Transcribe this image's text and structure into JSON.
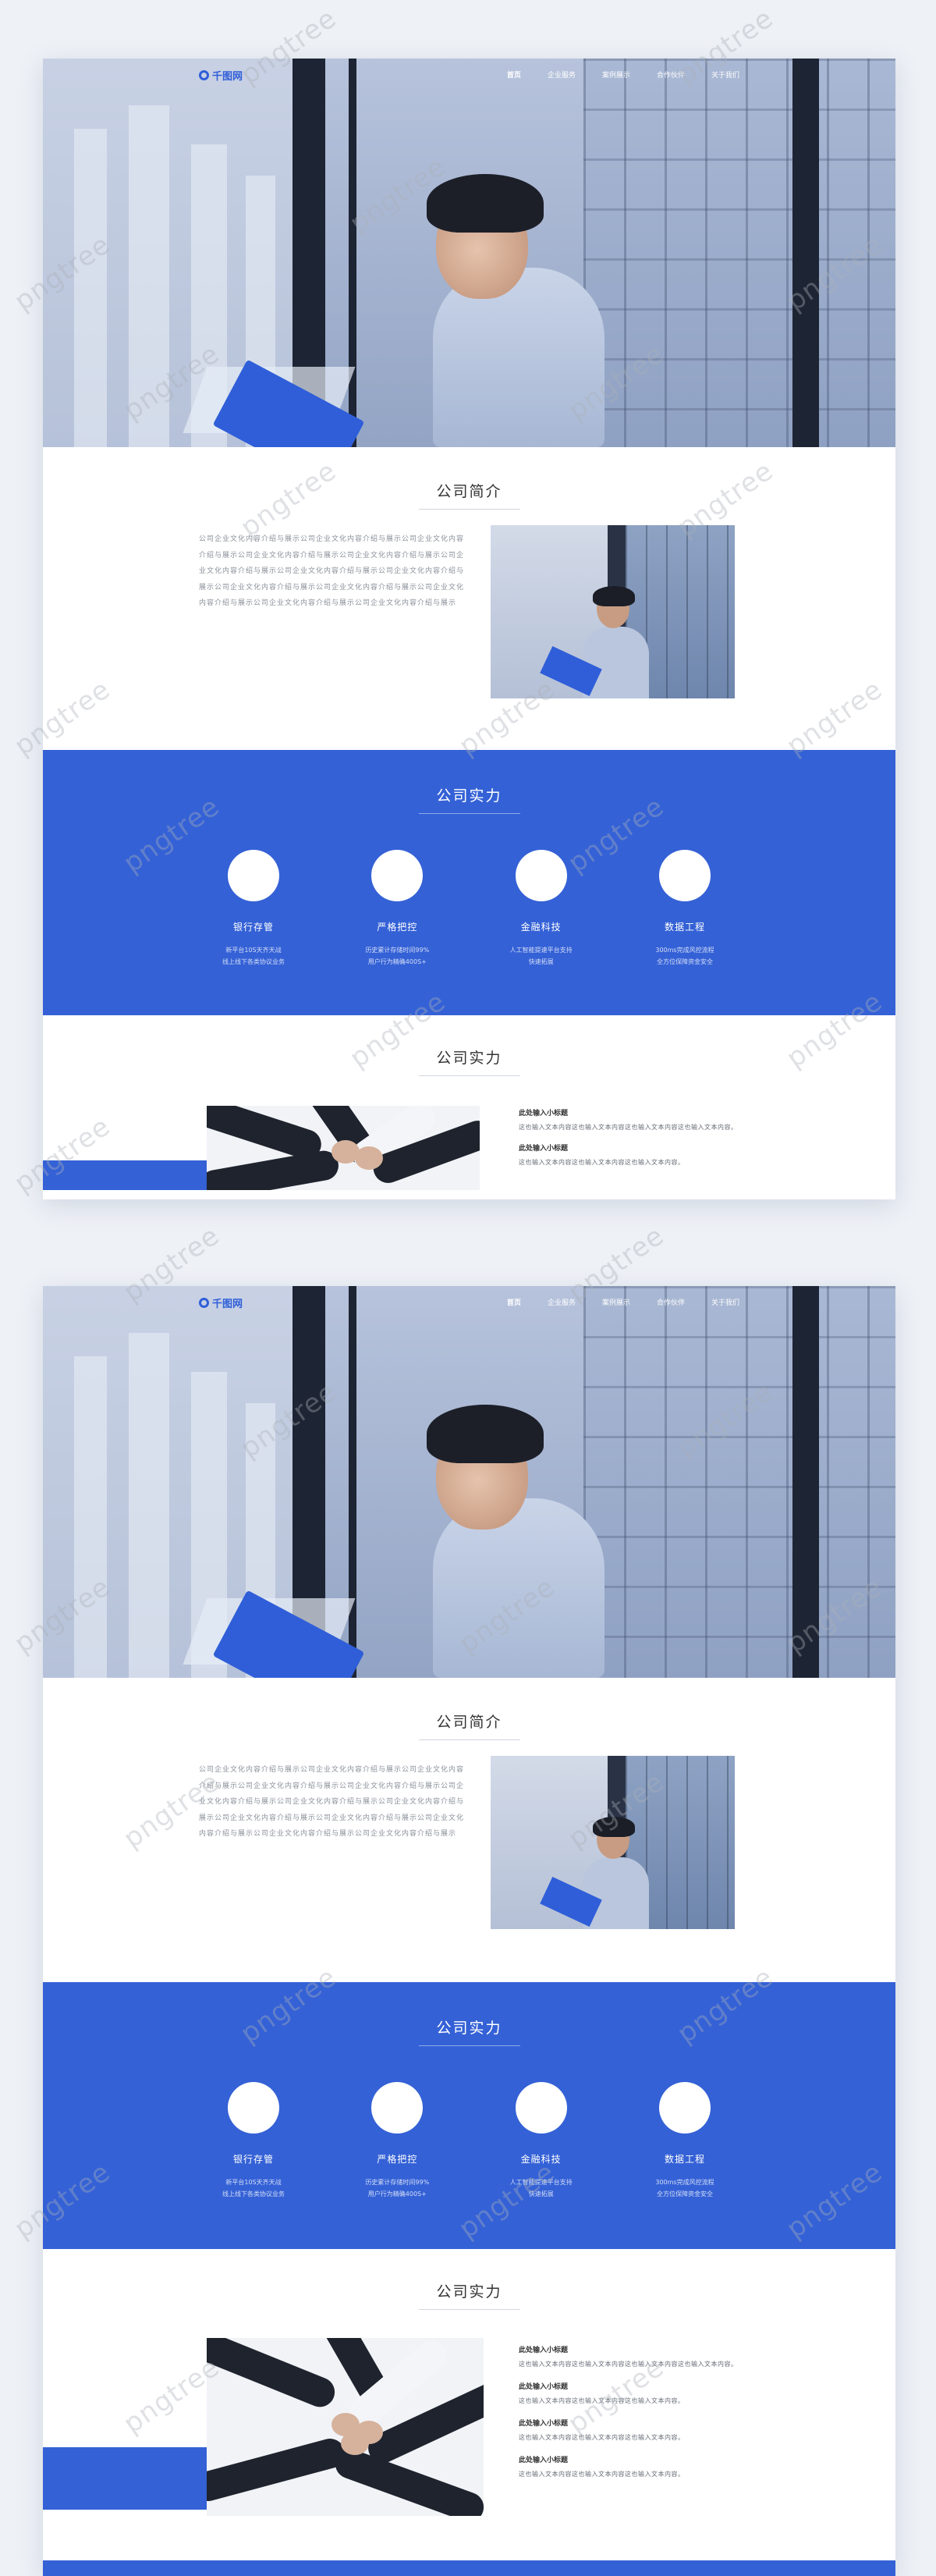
{
  "nav": {
    "logo": "千图网",
    "items": [
      {
        "label": "首页",
        "active": true
      },
      {
        "label": "企业服务",
        "active": false
      },
      {
        "label": "案例展示",
        "active": false
      },
      {
        "label": "合作伙伴",
        "active": false
      },
      {
        "label": "关于我们",
        "active": false
      }
    ]
  },
  "intro": {
    "title": "公司简介",
    "text": "公司企业文化内容介绍与展示公司企业文化内容介绍与展示公司企业文化内容介绍与展示公司企业文化内容介绍与展示公司企业文化内容介绍与展示公司企业文化内容介绍与展示公司企业文化内容介绍与展示公司企业文化内容介绍与展示公司企业文化内容介绍与展示公司企业文化内容介绍与展示公司企业文化内容介绍与展示公司企业文化内容介绍与展示公司企业文化内容介绍与展示"
  },
  "strength": {
    "title": "公司实力",
    "features": [
      {
        "title": "银行存管",
        "desc1": "新平台10S天齐天战",
        "desc2": "线上线下各类协议业务"
      },
      {
        "title": "严格把控",
        "desc1": "历史累计存储时间99%",
        "desc2": "用户行为精确400S+"
      },
      {
        "title": "金融科技",
        "desc1": "人工智能提速平台支持",
        "desc2": "快速拓展"
      },
      {
        "title": "数据工程",
        "desc1": "300ms完成风控流程",
        "desc2": "全方位保障资金安全"
      }
    ]
  },
  "strength2": {
    "title": "公司实力",
    "items_page1": [
      {
        "title": "此处输入小标题",
        "text": "这也输入文本内容这也输入文本内容这也输入文本内容这也输入文本内容。"
      },
      {
        "title": "此处输入小标题",
        "text": "这也输入文本内容这也输入文本内容这也输入文本内容。"
      }
    ],
    "items_page2": [
      {
        "title": "此处输入小标题",
        "text": "这也输入文本内容这也输入文本内容这也输入文本内容这也输入文本内容。"
      },
      {
        "title": "此处输入小标题",
        "text": "这也输入文本内容这也输入文本内容这也输入文本内容。"
      },
      {
        "title": "此处输入小标题",
        "text": "这也输入文本内容这也输入文本内容这也输入文本内容。"
      },
      {
        "title": "此处输入小标题",
        "text": "这也输入文本内容这也输入文本内容这也输入文本内容。"
      }
    ]
  },
  "watermark": "pngtree",
  "colors": {
    "accent": "#3461d6",
    "text": "#333333",
    "muted": "#8a8f99"
  }
}
